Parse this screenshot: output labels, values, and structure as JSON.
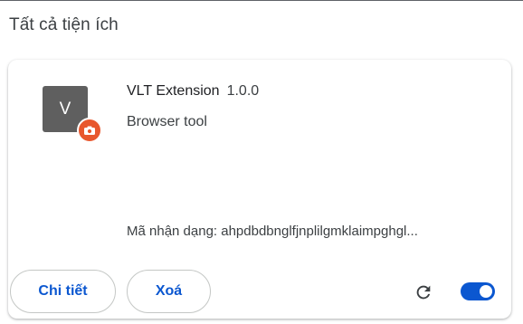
{
  "section": {
    "title": "Tất cả tiện ích"
  },
  "extension": {
    "icon_letter": "V",
    "icon_badge": "camera-badge-icon",
    "name": "VLT Extension",
    "version": "1.0.0",
    "description": "Browser tool",
    "id_text": "Mã nhận dạng: ahpdbdbnglfjnplilgmklaimpghgl...",
    "enabled": true
  },
  "actions": {
    "details_label": "Chi tiết",
    "remove_label": "Xoá",
    "reload_icon": "reload-icon",
    "toggle_icon": "toggle-switch"
  },
  "colors": {
    "accent": "#0b57d0",
    "icon_bg": "#5f5f5f",
    "badge_bg": "#e8572d",
    "text": "#202124"
  }
}
